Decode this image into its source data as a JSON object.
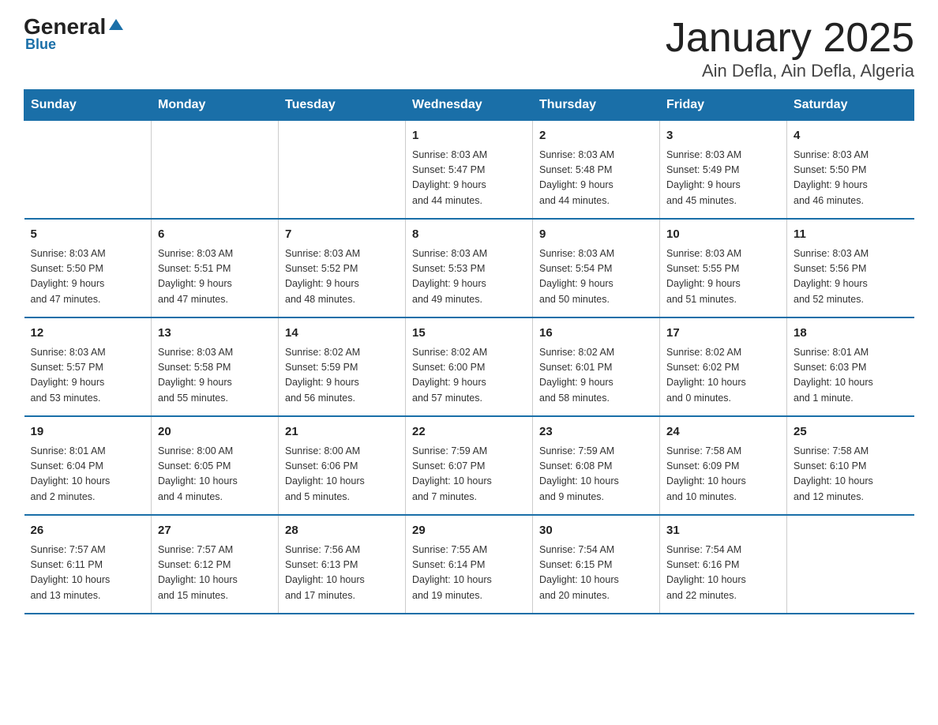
{
  "logo": {
    "text_general": "General",
    "triangle": "▲",
    "text_blue": "Blue"
  },
  "title": "January 2025",
  "subtitle": "Ain Defla, Ain Defla, Algeria",
  "days_of_week": [
    "Sunday",
    "Monday",
    "Tuesday",
    "Wednesday",
    "Thursday",
    "Friday",
    "Saturday"
  ],
  "weeks": [
    [
      {
        "day": "",
        "info": ""
      },
      {
        "day": "",
        "info": ""
      },
      {
        "day": "",
        "info": ""
      },
      {
        "day": "1",
        "info": "Sunrise: 8:03 AM\nSunset: 5:47 PM\nDaylight: 9 hours\nand 44 minutes."
      },
      {
        "day": "2",
        "info": "Sunrise: 8:03 AM\nSunset: 5:48 PM\nDaylight: 9 hours\nand 44 minutes."
      },
      {
        "day": "3",
        "info": "Sunrise: 8:03 AM\nSunset: 5:49 PM\nDaylight: 9 hours\nand 45 minutes."
      },
      {
        "day": "4",
        "info": "Sunrise: 8:03 AM\nSunset: 5:50 PM\nDaylight: 9 hours\nand 46 minutes."
      }
    ],
    [
      {
        "day": "5",
        "info": "Sunrise: 8:03 AM\nSunset: 5:50 PM\nDaylight: 9 hours\nand 47 minutes."
      },
      {
        "day": "6",
        "info": "Sunrise: 8:03 AM\nSunset: 5:51 PM\nDaylight: 9 hours\nand 47 minutes."
      },
      {
        "day": "7",
        "info": "Sunrise: 8:03 AM\nSunset: 5:52 PM\nDaylight: 9 hours\nand 48 minutes."
      },
      {
        "day": "8",
        "info": "Sunrise: 8:03 AM\nSunset: 5:53 PM\nDaylight: 9 hours\nand 49 minutes."
      },
      {
        "day": "9",
        "info": "Sunrise: 8:03 AM\nSunset: 5:54 PM\nDaylight: 9 hours\nand 50 minutes."
      },
      {
        "day": "10",
        "info": "Sunrise: 8:03 AM\nSunset: 5:55 PM\nDaylight: 9 hours\nand 51 minutes."
      },
      {
        "day": "11",
        "info": "Sunrise: 8:03 AM\nSunset: 5:56 PM\nDaylight: 9 hours\nand 52 minutes."
      }
    ],
    [
      {
        "day": "12",
        "info": "Sunrise: 8:03 AM\nSunset: 5:57 PM\nDaylight: 9 hours\nand 53 minutes."
      },
      {
        "day": "13",
        "info": "Sunrise: 8:03 AM\nSunset: 5:58 PM\nDaylight: 9 hours\nand 55 minutes."
      },
      {
        "day": "14",
        "info": "Sunrise: 8:02 AM\nSunset: 5:59 PM\nDaylight: 9 hours\nand 56 minutes."
      },
      {
        "day": "15",
        "info": "Sunrise: 8:02 AM\nSunset: 6:00 PM\nDaylight: 9 hours\nand 57 minutes."
      },
      {
        "day": "16",
        "info": "Sunrise: 8:02 AM\nSunset: 6:01 PM\nDaylight: 9 hours\nand 58 minutes."
      },
      {
        "day": "17",
        "info": "Sunrise: 8:02 AM\nSunset: 6:02 PM\nDaylight: 10 hours\nand 0 minutes."
      },
      {
        "day": "18",
        "info": "Sunrise: 8:01 AM\nSunset: 6:03 PM\nDaylight: 10 hours\nand 1 minute."
      }
    ],
    [
      {
        "day": "19",
        "info": "Sunrise: 8:01 AM\nSunset: 6:04 PM\nDaylight: 10 hours\nand 2 minutes."
      },
      {
        "day": "20",
        "info": "Sunrise: 8:00 AM\nSunset: 6:05 PM\nDaylight: 10 hours\nand 4 minutes."
      },
      {
        "day": "21",
        "info": "Sunrise: 8:00 AM\nSunset: 6:06 PM\nDaylight: 10 hours\nand 5 minutes."
      },
      {
        "day": "22",
        "info": "Sunrise: 7:59 AM\nSunset: 6:07 PM\nDaylight: 10 hours\nand 7 minutes."
      },
      {
        "day": "23",
        "info": "Sunrise: 7:59 AM\nSunset: 6:08 PM\nDaylight: 10 hours\nand 9 minutes."
      },
      {
        "day": "24",
        "info": "Sunrise: 7:58 AM\nSunset: 6:09 PM\nDaylight: 10 hours\nand 10 minutes."
      },
      {
        "day": "25",
        "info": "Sunrise: 7:58 AM\nSunset: 6:10 PM\nDaylight: 10 hours\nand 12 minutes."
      }
    ],
    [
      {
        "day": "26",
        "info": "Sunrise: 7:57 AM\nSunset: 6:11 PM\nDaylight: 10 hours\nand 13 minutes."
      },
      {
        "day": "27",
        "info": "Sunrise: 7:57 AM\nSunset: 6:12 PM\nDaylight: 10 hours\nand 15 minutes."
      },
      {
        "day": "28",
        "info": "Sunrise: 7:56 AM\nSunset: 6:13 PM\nDaylight: 10 hours\nand 17 minutes."
      },
      {
        "day": "29",
        "info": "Sunrise: 7:55 AM\nSunset: 6:14 PM\nDaylight: 10 hours\nand 19 minutes."
      },
      {
        "day": "30",
        "info": "Sunrise: 7:54 AM\nSunset: 6:15 PM\nDaylight: 10 hours\nand 20 minutes."
      },
      {
        "day": "31",
        "info": "Sunrise: 7:54 AM\nSunset: 6:16 PM\nDaylight: 10 hours\nand 22 minutes."
      },
      {
        "day": "",
        "info": ""
      }
    ]
  ]
}
